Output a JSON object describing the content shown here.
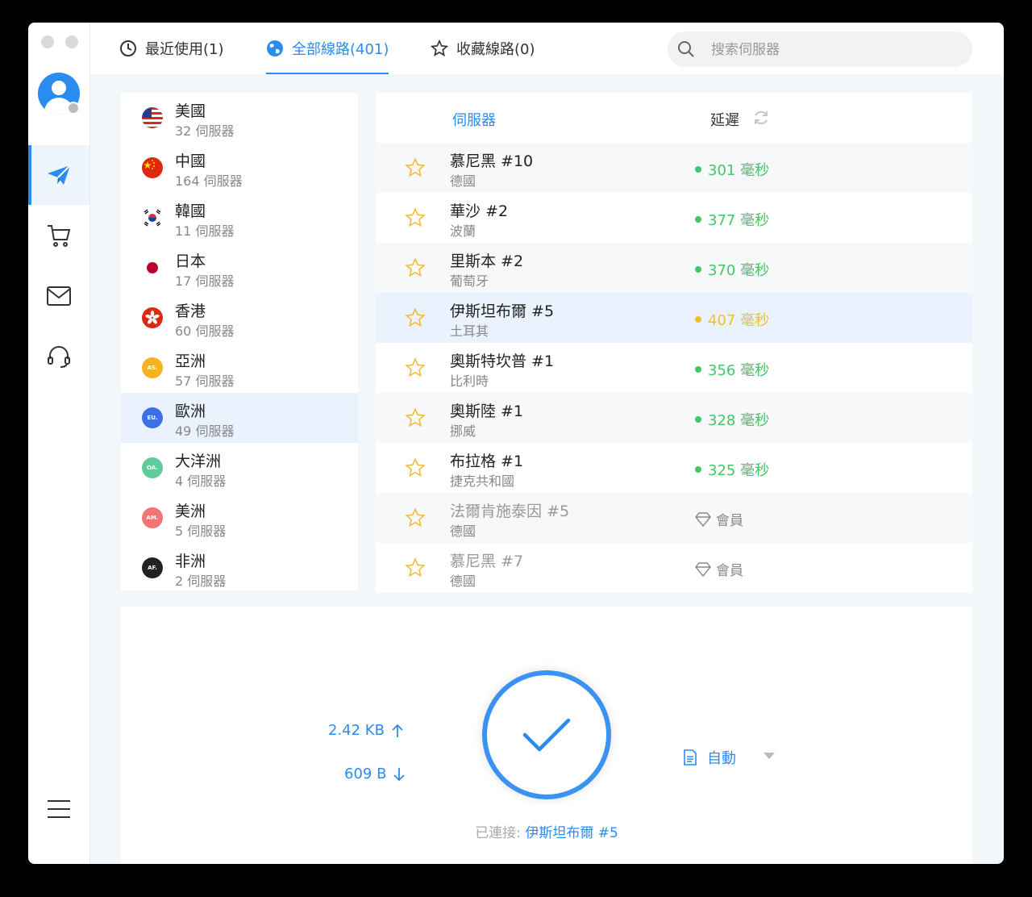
{
  "tabs": [
    {
      "label": "最近使用(1)",
      "icon": "clock-icon"
    },
    {
      "label": "全部線路(401)",
      "icon": "globe-icon",
      "active": true
    },
    {
      "label": "收藏線路(0)",
      "icon": "star-icon"
    }
  ],
  "search": {
    "placeholder": "搜索伺服器"
  },
  "sidebar": {
    "items": [
      {
        "name": "send-icon",
        "active": true
      },
      {
        "name": "cart-icon"
      },
      {
        "name": "mail-icon"
      },
      {
        "name": "headset-icon"
      }
    ]
  },
  "regions": [
    {
      "name": "美國",
      "count": "32 伺服器",
      "flag": "us"
    },
    {
      "name": "中國",
      "count": "164 伺服器",
      "flag": "cn"
    },
    {
      "name": "韓國",
      "count": "11 伺服器",
      "flag": "kr"
    },
    {
      "name": "日本",
      "count": "17 伺服器",
      "flag": "jp"
    },
    {
      "name": "香港",
      "count": "60 伺服器",
      "flag": "hk"
    },
    {
      "name": "亞洲",
      "count": "57 伺服器",
      "badge": "AS.",
      "color": "#f5b324"
    },
    {
      "name": "歐洲",
      "count": "49 伺服器",
      "badge": "EU.",
      "color": "#3d6fe8",
      "active": true
    },
    {
      "name": "大洋洲",
      "count": "4 伺服器",
      "badge": "OA.",
      "color": "#5dcc9a"
    },
    {
      "name": "美洲",
      "count": "5 伺服器",
      "badge": "AM.",
      "color": "#f27474"
    },
    {
      "name": "非洲",
      "count": "2 伺服器",
      "badge": "AF.",
      "color": "#222222"
    }
  ],
  "server_header": {
    "name": "伺服器",
    "latency": "延遲"
  },
  "servers": [
    {
      "name": "慕尼黑 #10",
      "country": "德國",
      "latency": "301 毫秒",
      "status": "good"
    },
    {
      "name": "華沙 #2",
      "country": "波蘭",
      "latency": "377 毫秒",
      "status": "good"
    },
    {
      "name": "里斯本 #2",
      "country": "葡萄牙",
      "latency": "370 毫秒",
      "status": "good"
    },
    {
      "name": "伊斯坦布爾 #5",
      "country": "土耳其",
      "latency": "407 毫秒",
      "status": "warn",
      "selected": true
    },
    {
      "name": "奧斯特坎普 #1",
      "country": "比利時",
      "latency": "356 毫秒",
      "status": "good"
    },
    {
      "name": "奧斯陸 #1",
      "country": "挪威",
      "latency": "328 毫秒",
      "status": "good"
    },
    {
      "name": "布拉格 #1",
      "country": "捷克共和國",
      "latency": "325 毫秒",
      "status": "good"
    },
    {
      "name": "法爾肯施泰因 #5",
      "country": "德國",
      "latency": "會員",
      "status": "member"
    },
    {
      "name": "慕尼黑 #7",
      "country": "德國",
      "latency": "會員",
      "status": "member"
    }
  ],
  "traffic": {
    "up": "2.42 KB",
    "down": "609 B"
  },
  "mode": {
    "label": "自動"
  },
  "connection": {
    "label": "已連接:",
    "server": "伊斯坦布爾 #5"
  },
  "colors": {
    "accent": "#2b8cf0",
    "good": "#41c766",
    "warn": "#f0c030"
  }
}
